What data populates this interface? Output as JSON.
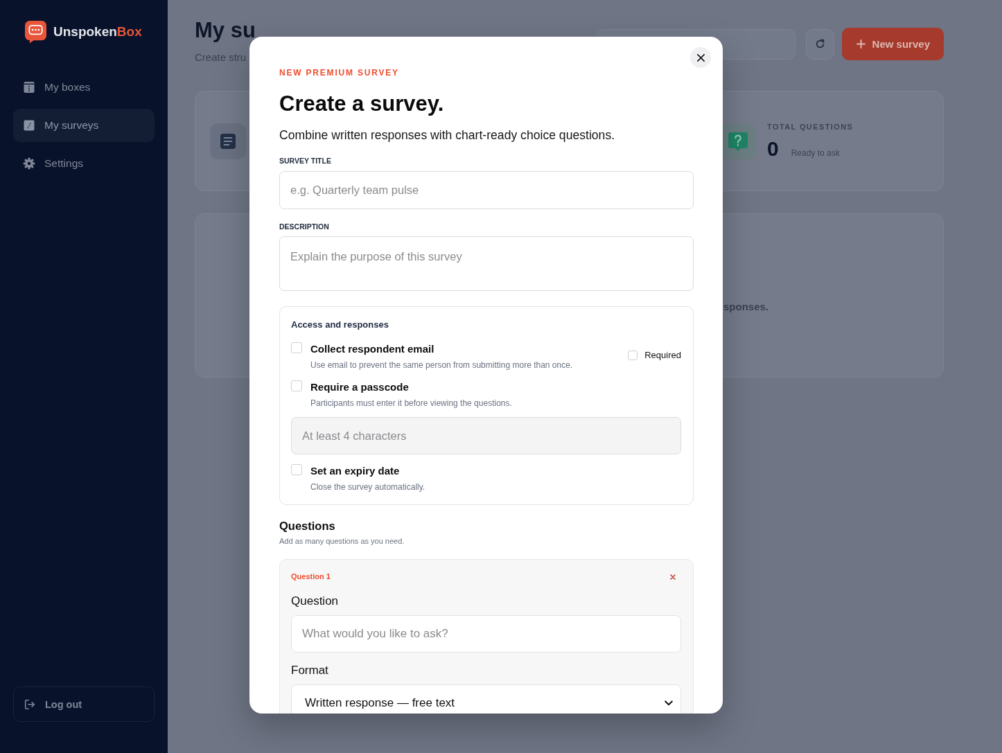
{
  "sidebar": {
    "brand": {
      "name": "Unspoken",
      "accent": "Box"
    },
    "nav": [
      {
        "label": "My boxes",
        "selected": false
      },
      {
        "label": "My surveys",
        "selected": true
      },
      {
        "label": "Settings",
        "selected": false
      }
    ],
    "logout": "Log out"
  },
  "header": {
    "title": "My su",
    "subtitle": "Create stru",
    "new_button": "New survey"
  },
  "stats": [
    {
      "kind": "surveys"
    },
    {
      "kind": "questions",
      "label": "TOTAL QUESTIONS",
      "value": "0",
      "note": "Ready to ask"
    }
  ],
  "empty_state": {
    "text": "sponses."
  },
  "modal": {
    "eyebrow": "NEW PREMIUM SURVEY",
    "title": "Create a survey.",
    "intro": "Combine written responses with chart-ready choice questions.",
    "fields": [
      {
        "kind": "input",
        "label": "SURVEY TITLE",
        "placeholder": "e.g. Quarterly team pulse"
      },
      {
        "kind": "textarea",
        "label": "DESCRIPTION",
        "placeholder": "Explain the purpose of this survey"
      }
    ],
    "access": {
      "title": "Access and responses",
      "options": [
        {
          "label": "Collect respondent email",
          "description": "Use email to prevent the same person from submitting more than once.",
          "checked": false,
          "required": {
            "label": "Required",
            "checked": false
          }
        },
        {
          "label": "Require a passcode",
          "description": "Participants must enter it before viewing the questions.",
          "checked": false,
          "input": {
            "placeholder": "At least 4 characters",
            "disabled": true
          }
        },
        {
          "label": "Set an expiry date",
          "description": "Close the survey automatically.",
          "checked": false
        }
      ]
    },
    "questions": {
      "title": "Questions",
      "hint": "Add as many questions as you need.",
      "items": [
        {
          "number": "Question 1",
          "question_label": "Question",
          "placeholder": "What would you like to ask?",
          "format_label": "Format",
          "format": "Written response — free text"
        }
      ]
    }
  }
}
